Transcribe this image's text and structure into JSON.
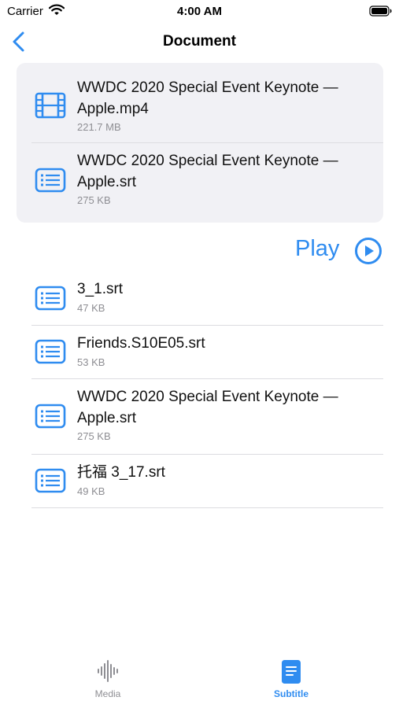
{
  "status_bar": {
    "carrier": "Carrier",
    "time": "4:00 AM"
  },
  "nav": {
    "title": "Document"
  },
  "selected": [
    {
      "name": "WWDC 2020 Special Event Keynote — Apple.mp4",
      "size": "221.7 MB",
      "icon": "film-icon"
    },
    {
      "name": "WWDC 2020 Special Event Keynote — Apple.srt",
      "size": "275 KB",
      "icon": "document-list-icon"
    }
  ],
  "play": {
    "label": "Play",
    "icon": "play-circle-icon"
  },
  "files": [
    {
      "name": "3_1.srt",
      "size": "47 KB",
      "icon": "document-list-icon"
    },
    {
      "name": "Friends.S10E05.srt",
      "size": "53 KB",
      "icon": "document-list-icon"
    },
    {
      "name": "WWDC 2020 Special Event Keynote — Apple.srt",
      "size": "275 KB",
      "icon": "document-list-icon"
    },
    {
      "name": "托福 3_17.srt",
      "size": "49 KB",
      "icon": "document-list-icon"
    }
  ],
  "tabs": [
    {
      "label": "Media",
      "icon": "waveform-icon",
      "active": false
    },
    {
      "label": "Subtitle",
      "icon": "document-fill-icon",
      "active": true
    }
  ],
  "colors": {
    "accent": "#2f8cf0",
    "inactive": "#8e8e93",
    "card_background": "#f1f1f5",
    "divider": "#dcdce0"
  }
}
